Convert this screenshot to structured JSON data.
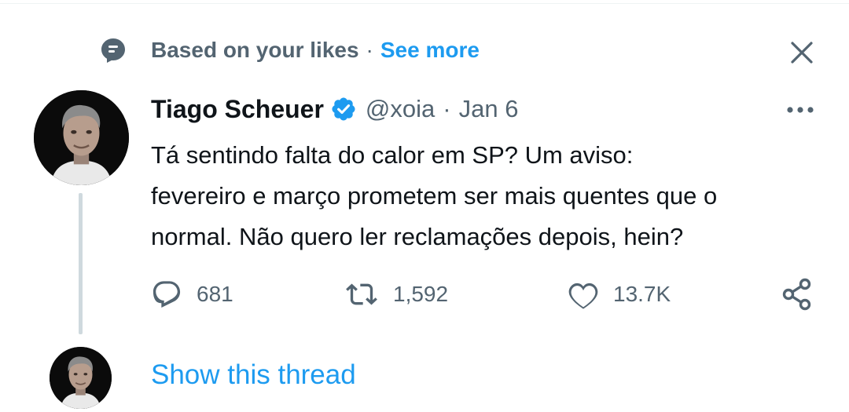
{
  "context": {
    "icon": "speech-bubble-icon",
    "text": "Based on your likes",
    "separator": "·",
    "link": "See more"
  },
  "tweet": {
    "author_name": "Tiago Scheuer",
    "verified_icon": "verified-badge-icon",
    "handle": "@xoia",
    "separator": "·",
    "date": "Jan 6",
    "text_lines": [
      "Tá sentindo falta do calor em SP? Um aviso:",
      "fevereiro e março prometem ser mais quentes que o",
      "normal. Não quero ler reclamações depois, hein?"
    ],
    "actions": {
      "reply_count": "681",
      "retweet_count": "1,592",
      "like_count": "13.7K"
    }
  },
  "thread": {
    "show_label": "Show this thread"
  },
  "colors": {
    "accent": "#1d9bf0",
    "secondary_text": "#536471",
    "primary_text": "#0f1419",
    "thread_line": "#cfd9de"
  }
}
